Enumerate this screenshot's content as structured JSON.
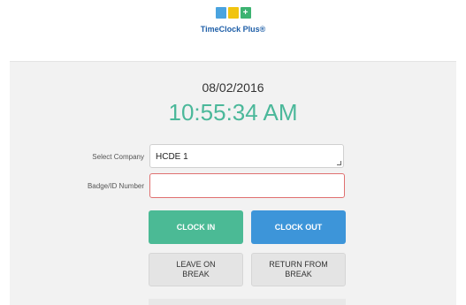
{
  "brand": {
    "logo_tiles": [
      "",
      "",
      "+"
    ],
    "name": "TimeClock Plus®"
  },
  "clock": {
    "date": "08/02/2016",
    "time": "10:55:34 AM"
  },
  "form": {
    "company_label": "Select Company",
    "company_value": "HCDE  1",
    "badge_label": "Badge/ID Number",
    "badge_value": ""
  },
  "buttons": {
    "clock_in": "CLOCK IN",
    "clock_out": "CLOCK OUT",
    "leave_on_break_line1": "LEAVE ON",
    "leave_on_break_line2": "BREAK",
    "return_from_break_line1": "RETURN FROM",
    "return_from_break_line2": "BREAK"
  },
  "colors": {
    "time_accent": "#4bb89a",
    "clock_in": "#4bba95",
    "clock_out": "#3d95d9",
    "badge_border_error": "#e07070"
  }
}
